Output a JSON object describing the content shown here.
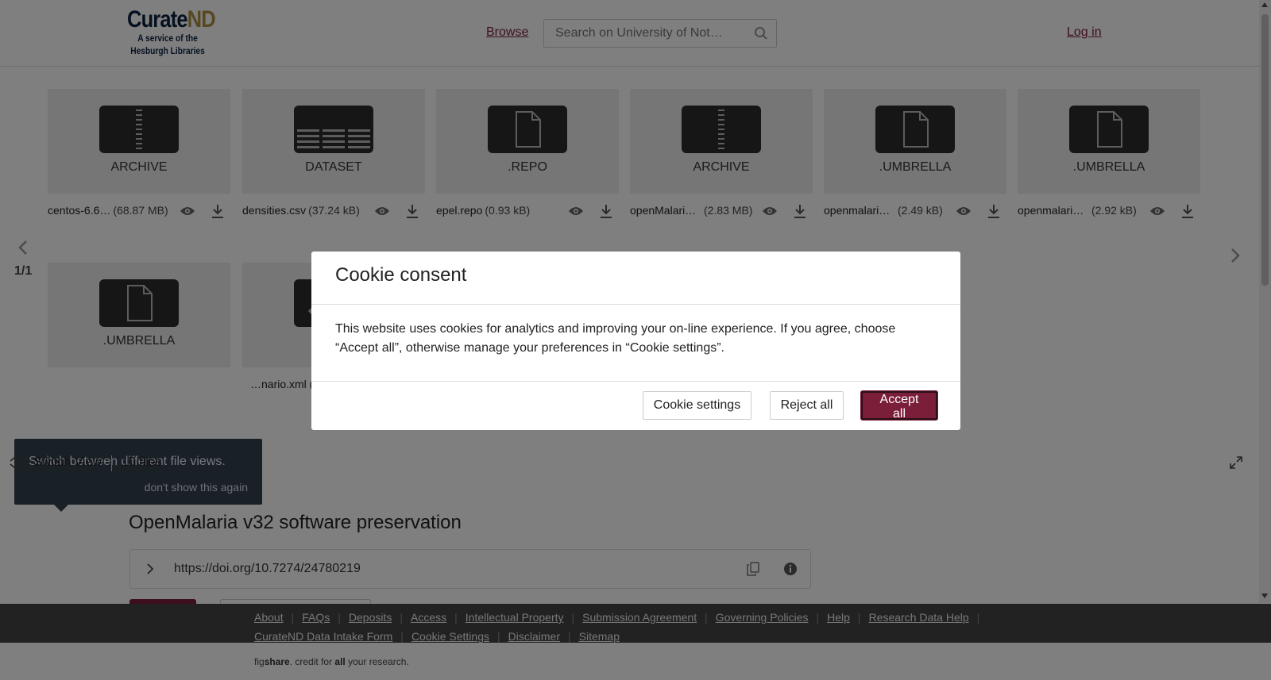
{
  "header": {
    "logo_brand": "Curate",
    "logo_brand_accent": "ND",
    "logo_sub_1": "A service of the",
    "logo_sub_2": "Hesburgh Libraries",
    "browse_label": "Browse",
    "search_placeholder": "Search on University of Not…",
    "login_label": "Log in"
  },
  "viewer": {
    "files_row1": [
      {
        "type": "ARCHIVE",
        "name": "centos-6.6…",
        "size": "(68.87 MB)",
        "icon": "zip-icon"
      },
      {
        "type": "DATASET",
        "name": "densities.csv",
        "size": "(37.24 kB)",
        "icon": "table-icon"
      },
      {
        "type": ".REPO",
        "name": "epel.repo",
        "size": "(0.93 kB)",
        "icon": "document-icon"
      },
      {
        "type": "ARCHIVE",
        "name": "openMalaria…",
        "size": "(2.83 MB)",
        "icon": "zip-icon"
      },
      {
        "type": ".UMBRELLA",
        "name": "openmalaria.…",
        "size": "(2.49 kB)",
        "icon": "document-icon"
      },
      {
        "type": ".UMBRELLA",
        "name": "openmalaria.…",
        "size": "(2.92 kB)",
        "icon": "document-icon"
      }
    ],
    "files_row2": [
      {
        "type": ".UMBRELLA",
        "name": "",
        "size": "",
        "icon": "document-icon"
      },
      {
        "type": "",
        "name": "…nario.xml (",
        "size": "",
        "icon": "document-icon"
      }
    ],
    "pager": "1/1",
    "tooltip_text": "Switch between different file views.",
    "tooltip_dismiss": "don't show this again",
    "switch_view_label": "Switch View",
    "files_count": "10 files"
  },
  "item": {
    "title": "OpenMalaria v32 software preservation",
    "doi": "https://doi.org/10.7274/24780219"
  },
  "footer": {
    "links": [
      "About",
      "FAQs",
      "Deposits",
      "Access",
      "Intellectual Property",
      "Submission Agreement",
      "Governing Policies",
      "Help",
      "Research Data Help",
      "CurateND Data Intake Form",
      "Cookie Settings",
      "Disclaimer",
      "Sitemap"
    ],
    "figshare_prefix": "fig",
    "figshare_brand": "share",
    "figshare_mid": ". credit for ",
    "figshare_all": "all",
    "figshare_suffix": " your research."
  },
  "cookie_modal": {
    "title": "Cookie consent",
    "body": "This website uses cookies for analytics and improving your on-line experience. If you agree, choose “Accept all”, otherwise manage your preferences in “Cookie settings”.",
    "settings_label": "Cookie settings",
    "reject_label": "Reject all",
    "accept_label": "Accept all"
  },
  "colors": {
    "accent": "#7b1e3a",
    "overlay": "rgba(0,0,0,0.5)",
    "footer_bg": "#444444"
  }
}
